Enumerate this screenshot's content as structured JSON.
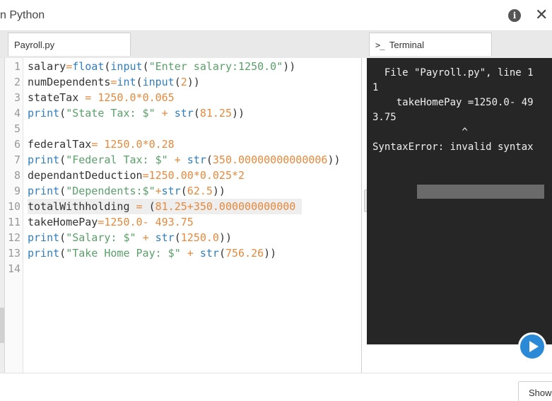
{
  "window": {
    "title": "n Python",
    "info_icon_glyph": "i",
    "close_icon_glyph": "✕"
  },
  "tabs": {
    "editor_label": "Payroll.py",
    "terminal_prompt": ">_",
    "terminal_label": "Terminal"
  },
  "editor": {
    "line_numbers": [
      "1",
      "2",
      "3",
      "4",
      "5",
      "6",
      "7",
      "8",
      "9",
      "10",
      "11",
      "12",
      "13",
      "14"
    ],
    "highlighted_line": 10,
    "lines": [
      [
        [
          "pl",
          "salary"
        ],
        [
          "op",
          "="
        ],
        [
          "kw",
          "float"
        ],
        [
          "pl",
          "("
        ],
        [
          "kw",
          "input"
        ],
        [
          "pl",
          "("
        ],
        [
          "str",
          "\"Enter salary:1250.0\""
        ],
        [
          "pl",
          "))"
        ]
      ],
      [
        [
          "pl",
          "numDependents"
        ],
        [
          "op",
          "="
        ],
        [
          "kw",
          "int"
        ],
        [
          "pl",
          "("
        ],
        [
          "kw",
          "input"
        ],
        [
          "pl",
          "("
        ],
        [
          "num",
          "2"
        ],
        [
          "pl",
          "))"
        ]
      ],
      [
        [
          "pl",
          "stateTax "
        ],
        [
          "op",
          "="
        ],
        [
          "pl",
          " "
        ],
        [
          "num",
          "1250.0"
        ],
        [
          "op",
          "*"
        ],
        [
          "num",
          "0.065"
        ]
      ],
      [
        [
          "kw",
          "print"
        ],
        [
          "pl",
          "("
        ],
        [
          "str",
          "\"State Tax: $\""
        ],
        [
          "pl",
          " "
        ],
        [
          "op",
          "+"
        ],
        [
          "pl",
          " "
        ],
        [
          "kw",
          "str"
        ],
        [
          "pl",
          "("
        ],
        [
          "num",
          "81.25"
        ],
        [
          "pl",
          "))"
        ]
      ],
      [],
      [
        [
          "pl",
          "federalTax"
        ],
        [
          "op",
          "="
        ],
        [
          "pl",
          " "
        ],
        [
          "num",
          "1250.0"
        ],
        [
          "op",
          "*"
        ],
        [
          "num",
          "0.28"
        ]
      ],
      [
        [
          "kw",
          "print"
        ],
        [
          "pl",
          "("
        ],
        [
          "str",
          "\"Federal Tax: $\""
        ],
        [
          "pl",
          " "
        ],
        [
          "op",
          "+"
        ],
        [
          "pl",
          " "
        ],
        [
          "kw",
          "str"
        ],
        [
          "pl",
          "("
        ],
        [
          "num",
          "350.00000000000006"
        ],
        [
          "pl",
          "))"
        ]
      ],
      [
        [
          "pl",
          "dependantDeduction"
        ],
        [
          "op",
          "="
        ],
        [
          "num",
          "1250.00"
        ],
        [
          "op",
          "*"
        ],
        [
          "num",
          "0.025"
        ],
        [
          "op",
          "*"
        ],
        [
          "num",
          "2"
        ]
      ],
      [
        [
          "kw",
          "print"
        ],
        [
          "pl",
          "("
        ],
        [
          "str",
          "\"Dependents:$\""
        ],
        [
          "op",
          "+"
        ],
        [
          "kw",
          "str"
        ],
        [
          "pl",
          "("
        ],
        [
          "num",
          "62.5"
        ],
        [
          "pl",
          "))"
        ]
      ],
      [
        [
          "pl",
          "totalWithholding "
        ],
        [
          "op",
          "="
        ],
        [
          "pl",
          " ("
        ],
        [
          "num",
          "81.25"
        ],
        [
          "op",
          "+"
        ],
        [
          "num",
          "350.000000000000"
        ],
        [
          "pl",
          " "
        ]
      ],
      [
        [
          "pl",
          "takeHomePay"
        ],
        [
          "op",
          "="
        ],
        [
          "num",
          "1250.0"
        ],
        [
          "op",
          "-"
        ],
        [
          "pl",
          " "
        ],
        [
          "num",
          "493.75"
        ]
      ],
      [
        [
          "kw",
          "print"
        ],
        [
          "pl",
          "("
        ],
        [
          "str",
          "\"Salary: $\""
        ],
        [
          "pl",
          " "
        ],
        [
          "op",
          "+"
        ],
        [
          "pl",
          " "
        ],
        [
          "kw",
          "str"
        ],
        [
          "pl",
          "("
        ],
        [
          "num",
          "1250.0"
        ],
        [
          "pl",
          "))"
        ]
      ],
      [
        [
          "kw",
          "print"
        ],
        [
          "pl",
          "("
        ],
        [
          "str",
          "\"Take Home Pay: $\""
        ],
        [
          "pl",
          " "
        ],
        [
          "op",
          "+"
        ],
        [
          "pl",
          " "
        ],
        [
          "kw",
          "str"
        ],
        [
          "pl",
          "("
        ],
        [
          "num",
          "756.26"
        ],
        [
          "pl",
          "))"
        ]
      ],
      []
    ]
  },
  "terminal": {
    "output_lines": [
      "  File \"Payroll.py\", line 1",
      "1",
      "    takeHomePay =1250.0- 49",
      "3.75",
      "               ^",
      "SyntaxError: invalid syntax"
    ]
  },
  "buttons": {
    "show_label": "Show"
  },
  "colors": {
    "keyword": "#2f7fbf",
    "string": "#5aa06a",
    "number": "#e6893c",
    "terminal_bg": "#262626",
    "run_button": "#2b8ad7"
  }
}
